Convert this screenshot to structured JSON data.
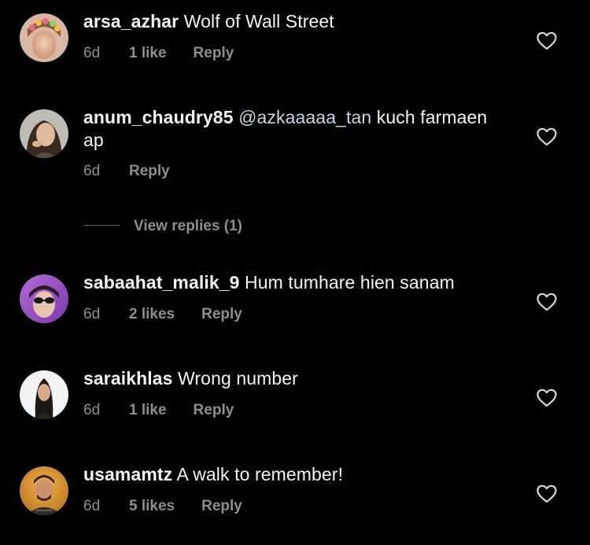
{
  "colors": {
    "background": "#000000",
    "text": "#f5f5f5",
    "secondary": "#8e8e8e",
    "mention": "#c7d3e6"
  },
  "comments": [
    {
      "username": "arsa_azhar",
      "text": "Wolf of Wall Street",
      "time": "6d",
      "likes": "1 like",
      "reply": "Reply",
      "avatar_icon": "avatar-woman-flower-crown-icon"
    },
    {
      "username": "anum_chaudry85",
      "mention": "@azkaaaaa_tan",
      "text": "kuch farmaen ap",
      "time": "6d",
      "likes": "",
      "reply": "Reply",
      "avatar_icon": "avatar-woman-portrait-icon",
      "view_replies": "View replies (1)"
    },
    {
      "username": "sabaahat_malik_9",
      "text": "Hum tumhare hien sanam",
      "time": "6d",
      "likes": "2 likes",
      "reply": "Reply",
      "avatar_icon": "avatar-woman-sunglasses-icon"
    },
    {
      "username": "saraikhlas",
      "text": "Wrong number",
      "time": "6d",
      "likes": "1 like",
      "reply": "Reply",
      "avatar_icon": "avatar-woman-white-bg-icon"
    },
    {
      "username": "usamamtz",
      "text": "A walk to remember!",
      "time": "6d",
      "likes": "5 likes",
      "reply": "Reply",
      "avatar_icon": "avatar-man-portrait-icon"
    }
  ],
  "heart_icon": "heart-outline-icon"
}
